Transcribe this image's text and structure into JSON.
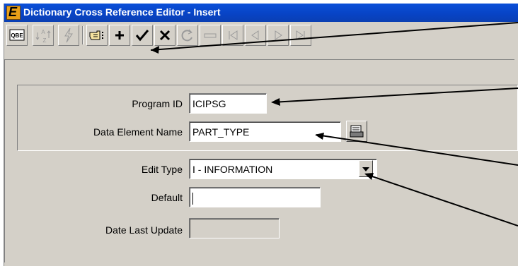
{
  "window": {
    "title": "Dictionary Cross Reference Editor - Insert",
    "app_icon_letter": "E"
  },
  "toolbar": {
    "buttons": [
      {
        "name": "qbe",
        "text": "QBE"
      },
      {
        "name": "sort",
        "text": "A→Z"
      },
      {
        "name": "lightning",
        "text": ""
      },
      {
        "name": "select",
        "text": ""
      },
      {
        "name": "add",
        "text": "+"
      },
      {
        "name": "accept",
        "text": "✓"
      },
      {
        "name": "cancel",
        "text": "✕"
      },
      {
        "name": "refresh",
        "text": ""
      },
      {
        "name": "remove",
        "text": ""
      },
      {
        "name": "first",
        "text": ""
      },
      {
        "name": "prev",
        "text": ""
      },
      {
        "name": "next",
        "text": ""
      },
      {
        "name": "last",
        "text": ""
      }
    ]
  },
  "form": {
    "program_id": {
      "label": "Program ID",
      "value": "ICIPSG"
    },
    "data_element_name": {
      "label": "Data Element Name",
      "value": "PART_TYPE"
    },
    "edit_type": {
      "label": "Edit Type",
      "value": "I - INFORMATION"
    },
    "default": {
      "label": "Default",
      "value": ""
    },
    "date_last_update": {
      "label": "Date Last Update",
      "value": ""
    }
  }
}
